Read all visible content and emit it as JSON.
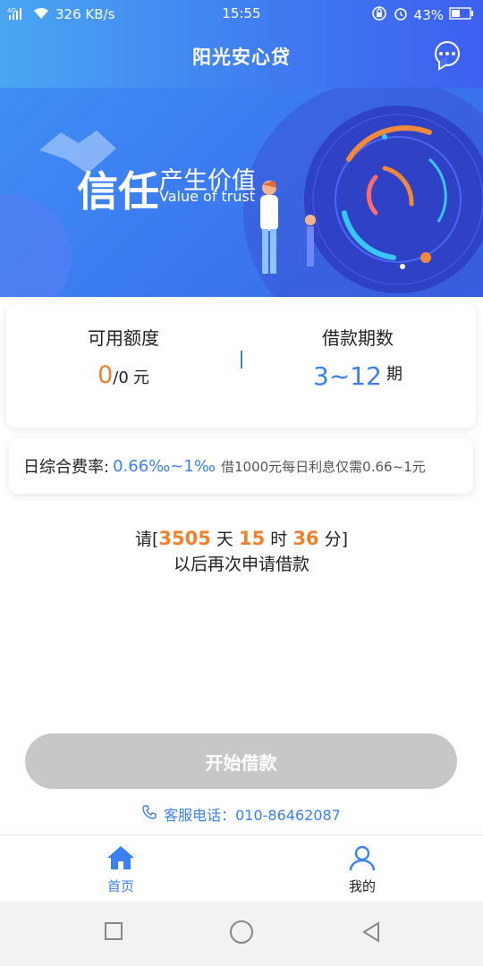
{
  "status_bar": {
    "network": "4G",
    "speed": "326 KB/s",
    "time": "15:55",
    "battery": "43%"
  },
  "header": {
    "title": "阳光安心贷",
    "chat_icon": "chat-bubble-icon"
  },
  "banner": {
    "slogan_big": "信任",
    "slogan_cn": "产生价值",
    "slogan_en": "Value of trust"
  },
  "quota_card": {
    "available_label": "可用额度",
    "available_used": "0",
    "available_rest": "/0",
    "available_unit": "元",
    "term_label": "借款期数",
    "term_value": "3~12",
    "term_unit": "期"
  },
  "rate_card": {
    "label": "日综合费率:",
    "value": "0.66‰~1‰",
    "note": "借1000元每日利息仅需0.66~1元"
  },
  "countdown": {
    "prefix": "请[",
    "days": "3505",
    "days_unit": "天",
    "hours": "15",
    "hours_unit": "时",
    "minutes": "36",
    "minutes_unit": "分]",
    "line2": "以后再次申请借款"
  },
  "start_button": {
    "label": "开始借款"
  },
  "hotline": {
    "label": "客服电话：010-86462087"
  },
  "tabbar": {
    "home_label": "首页",
    "mine_label": "我的"
  },
  "colors": {
    "accent": "#3c7ff0",
    "highlight": "#f0812d",
    "disabled_button": "#c7c7c7"
  }
}
